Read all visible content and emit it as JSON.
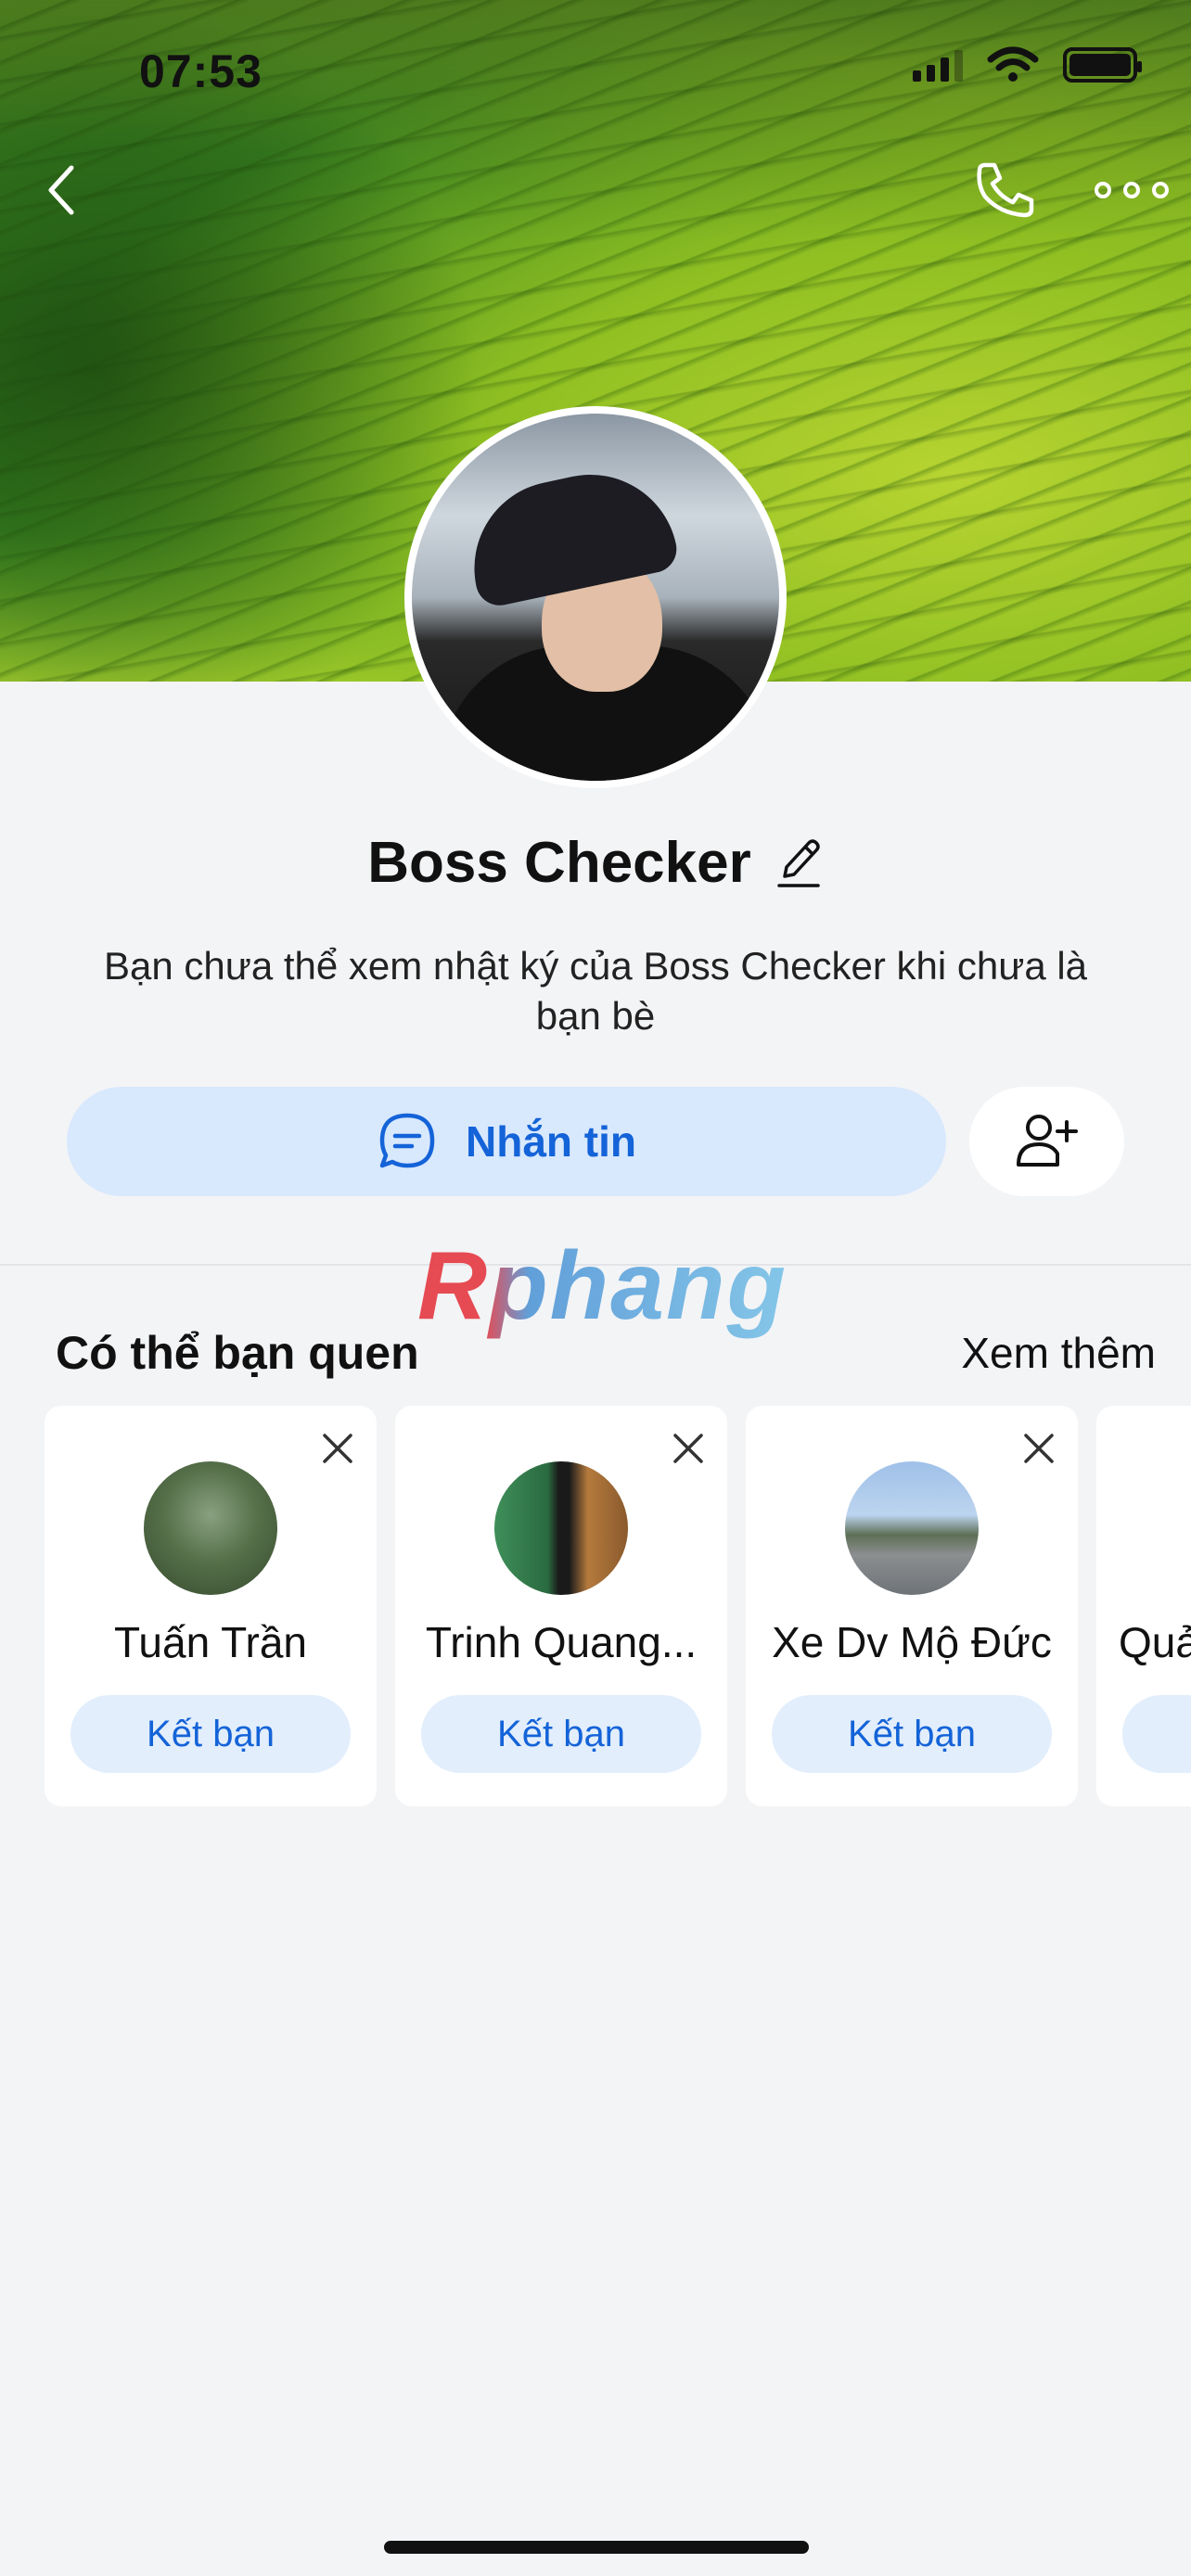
{
  "status_bar": {
    "time": "07:53"
  },
  "profile": {
    "name": "Boss Checker",
    "privacy_note": "Bạn chưa thể xem nhật ký của Boss Checker khi chưa là bạn bè"
  },
  "actions": {
    "message_label": "Nhắn tin"
  },
  "watermark": "Rphang",
  "suggestions": {
    "title": "Có thể bạn quen",
    "see_more": "Xem thêm",
    "items": [
      {
        "name": "Tuấn Trần",
        "button": "Kết bạn"
      },
      {
        "name": "Trinh Quang...",
        "button": "Kết bạn"
      },
      {
        "name": "Xe Dv Mộ Đức",
        "button": "Kết bạn"
      },
      {
        "name": "Quả",
        "button": ""
      }
    ]
  },
  "colors": {
    "accent": "#1463d8",
    "message_button_bg": "#d8e8fd",
    "friend_button_bg": "#e2eefc",
    "page_bg": "#f3f4f6"
  }
}
